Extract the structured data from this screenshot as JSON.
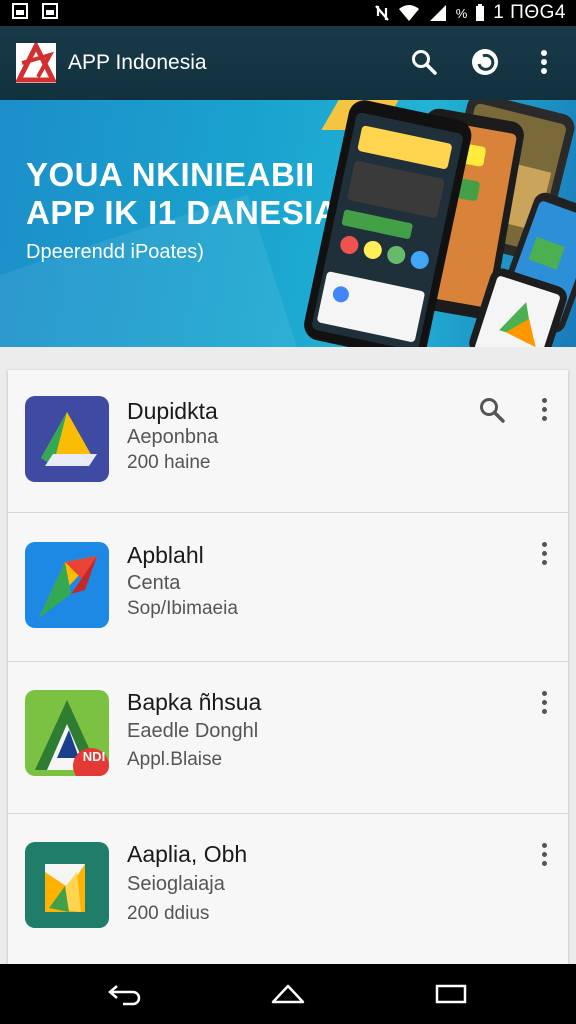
{
  "status_bar": {
    "time": "1 ΠΘG4",
    "battery_text": "%"
  },
  "app_bar": {
    "title": "APP Indonesia"
  },
  "hero": {
    "headline_1": "YOUA NKINIEABII",
    "headline_2": "APP IK I1 DANESIA",
    "subtitle": "Dpeerendd iPoates)"
  },
  "apps": [
    {
      "name": "Dupidkta",
      "line2": "Aeponbna",
      "line3": "200 haine"
    },
    {
      "name": "Apblahl",
      "line2": "Centa",
      "line3": "Sop/Ibimaeia"
    },
    {
      "name": "Bapka ñhsua",
      "line2": "Eaedle Donghl",
      "line3": "Appl.Blaise",
      "badge": "NDI"
    },
    {
      "name": "Aaplia, Obh",
      "line2": "Seioglaiaja",
      "line3": "200 ddius"
    }
  ],
  "colors": {
    "app_bar": "#183a49",
    "accent_blue": "#1c8ec9",
    "logo_red": "#d32f2f"
  },
  "icons": [
    "search-icon",
    "refresh-icon",
    "more-vert-icon",
    "back-icon",
    "home-icon",
    "recents-icon"
  ]
}
